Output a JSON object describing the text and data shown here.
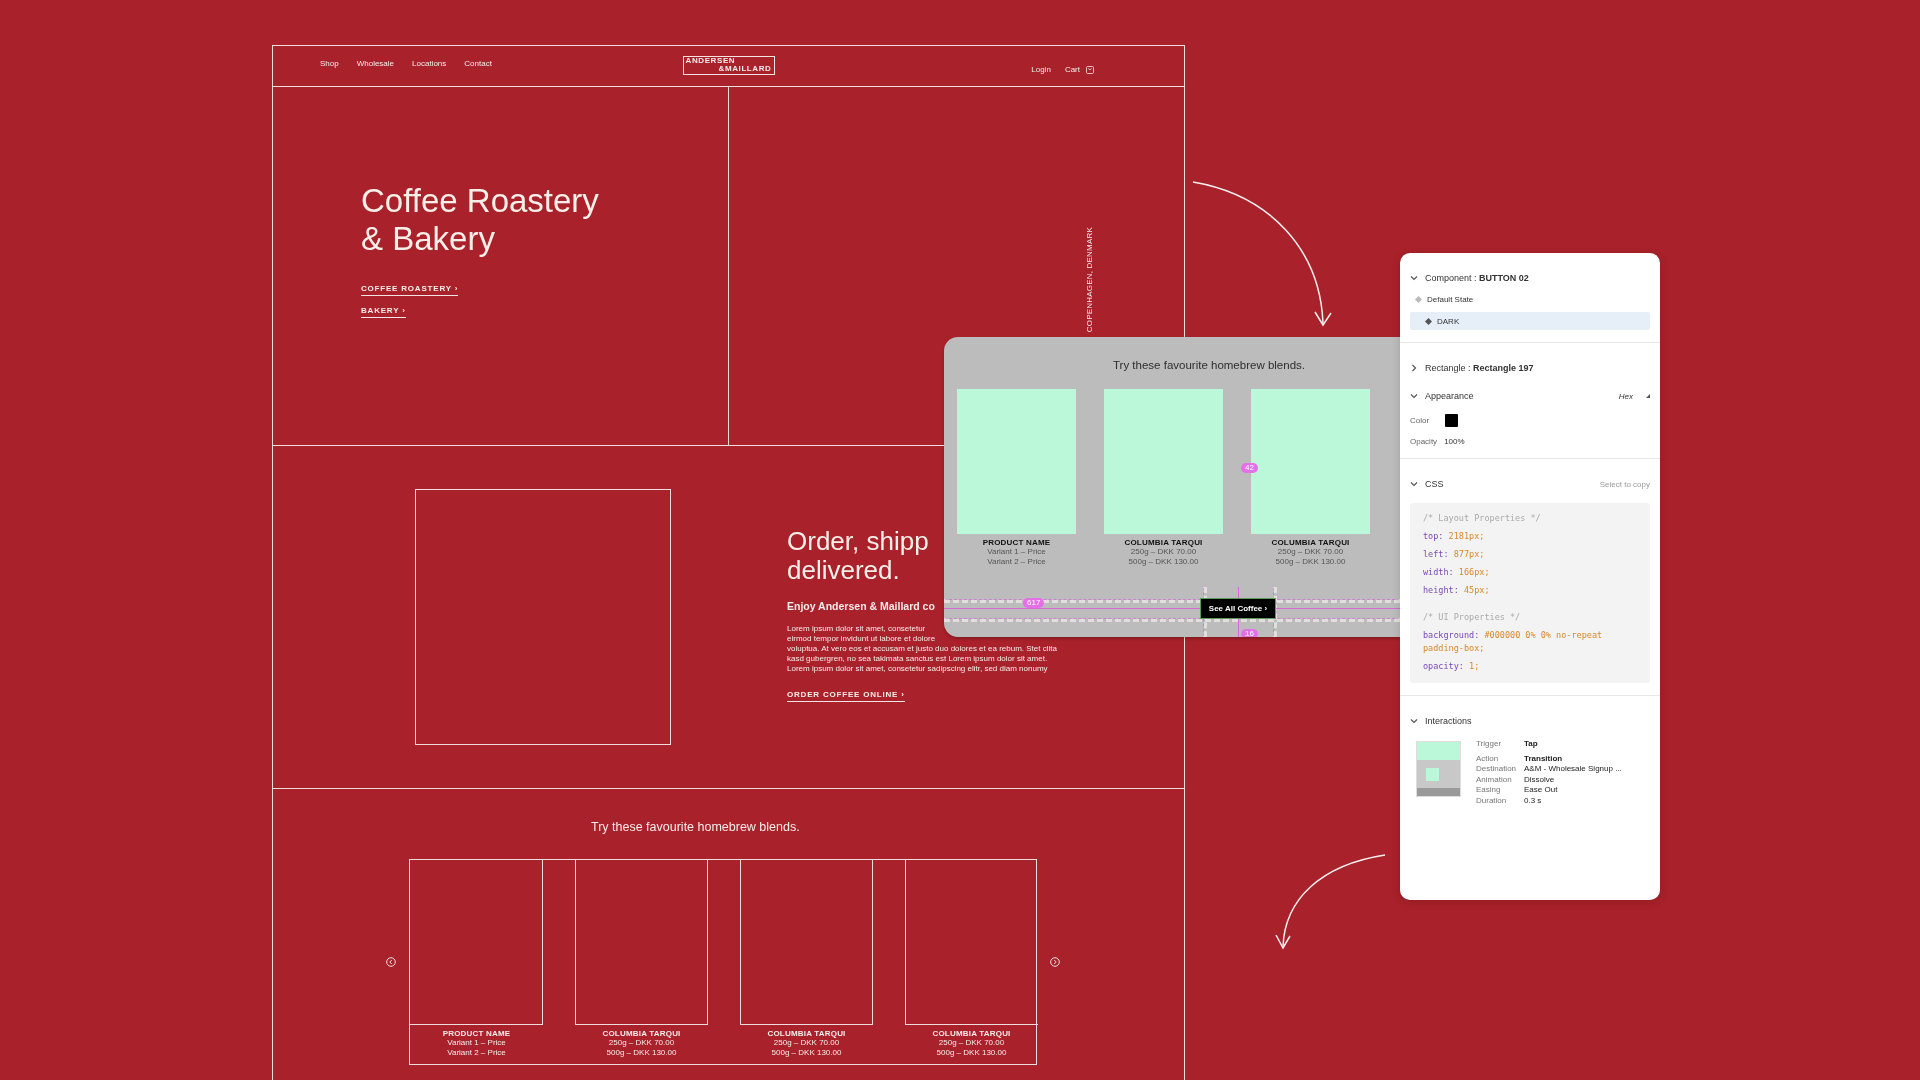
{
  "site_mockup": {
    "nav": {
      "links": [
        "Shop",
        "Wholesale",
        "Locations",
        "Contact"
      ],
      "logo": [
        "ANDERSEN",
        "&MAILLARD"
      ],
      "account": [
        "Login",
        "Cart"
      ]
    },
    "hero": {
      "title_lines": [
        "Coffee Roastery",
        "& Bakery"
      ],
      "links": [
        "COFFEE ROASTERY ›",
        "BAKERY ›"
      ],
      "location": "COPENHAGEN, DENMARK"
    },
    "order": {
      "title_lines": [
        "Order, shipp",
        "delivered."
      ],
      "subtitle": "Enjoy Andersen & Maillard co",
      "body_lines": [
        "Lorem ipsum dolor sit amet, consetetur",
        "eirmod tempor invidunt ut labore et dolore",
        "voluptua. At vero eos et accusam et justo duo dolores et ea rebum. Stet clita",
        "kasd gubergren, no sea takimata sanctus est Lorem ipsum dolor sit amet.",
        "Lorem ipsum dolor sit amet, consetetur sadipscing elitr, sed diam nonumy"
      ],
      "link": "ORDER COFFEE ONLINE ›"
    },
    "blends": {
      "title": "Try these favourite homebrew blends.",
      "products": [
        {
          "name": "PRODUCT NAME",
          "variants": [
            "Variant 1 – Price",
            "Variant 2 – Price"
          ]
        },
        {
          "name": "COLUMBIA TARQUI",
          "variants": [
            "250g – DKK 70.00",
            "500g – DKK 130.00"
          ]
        },
        {
          "name": "COLUMBIA TARQUI",
          "variants": [
            "250g – DKK 70.00",
            "500g – DKK 130.00"
          ]
        },
        {
          "name": "COLUMBIA TARQUI",
          "variants": [
            "250g – DKK 70.00",
            "500g – DKK 130.00"
          ]
        }
      ]
    }
  },
  "preview": {
    "title": "Try these favourite homebrew blends.",
    "products": [
      {
        "name": "PRODUCT NAME",
        "variants": [
          "Variant 1 – Price",
          "Variant 2 – Price"
        ]
      },
      {
        "name": "COLUMBIA TARQUI",
        "variants": [
          "250g – DKK 70.00",
          "500g – DKK 130.00"
        ]
      },
      {
        "name": "COLUMBIA TARQUI",
        "variants": [
          "250g – DKK 70.00",
          "500g – DKK 130.00"
        ]
      }
    ],
    "button": "See All Coffee ›",
    "measures": [
      "617",
      "42",
      "16"
    ]
  },
  "inspector": {
    "component": {
      "label": "Component : ",
      "name": "BUTTON 02",
      "expanded": true,
      "states": [
        {
          "name": "Default State",
          "selected": false
        },
        {
          "name": "DARK",
          "selected": true
        }
      ]
    },
    "rectangle": {
      "label": "Rectangle : ",
      "name": "Rectangle 197",
      "expanded": false
    },
    "appearance": {
      "title": "Appearance",
      "expanded": true,
      "mode": "Hex",
      "color_label": "Color",
      "color": "#000000",
      "opacity_label": "Opacity",
      "opacity": "100%"
    },
    "css": {
      "title": "CSS",
      "expanded": true,
      "hint": "Select to copy",
      "lines": [
        {
          "kind": "comment",
          "text": "/* Layout Properties */"
        },
        {
          "kind": "prop",
          "name": "top:",
          "value": "2181px;"
        },
        {
          "kind": "prop",
          "name": "left:",
          "value": "877px;"
        },
        {
          "kind": "prop",
          "name": "width:",
          "value": "166px;"
        },
        {
          "kind": "prop",
          "name": "height:",
          "value": "45px;"
        },
        {
          "kind": "comment",
          "text": "/* UI Properties */"
        },
        {
          "kind": "prop",
          "name": "background:",
          "value": "#000000 0% 0% no-repeat padding-box;"
        },
        {
          "kind": "prop",
          "name": "opacity:",
          "value": "1;"
        }
      ]
    },
    "interactions": {
      "title": "Interactions",
      "expanded": true,
      "rows": [
        {
          "label": "Trigger",
          "value": "Tap",
          "bold": true
        },
        {
          "label": "Action",
          "value": "Transition",
          "bold": true
        },
        {
          "label": "Destination",
          "value": "A&M - Wholesale Signup ...",
          "bold": false
        },
        {
          "label": "Animation",
          "value": "Dissolve",
          "bold": false
        },
        {
          "label": "Easing",
          "value": "Ease Out",
          "bold": false
        },
        {
          "label": "Duration",
          "value": "0.3 s",
          "bold": false
        }
      ]
    }
  }
}
